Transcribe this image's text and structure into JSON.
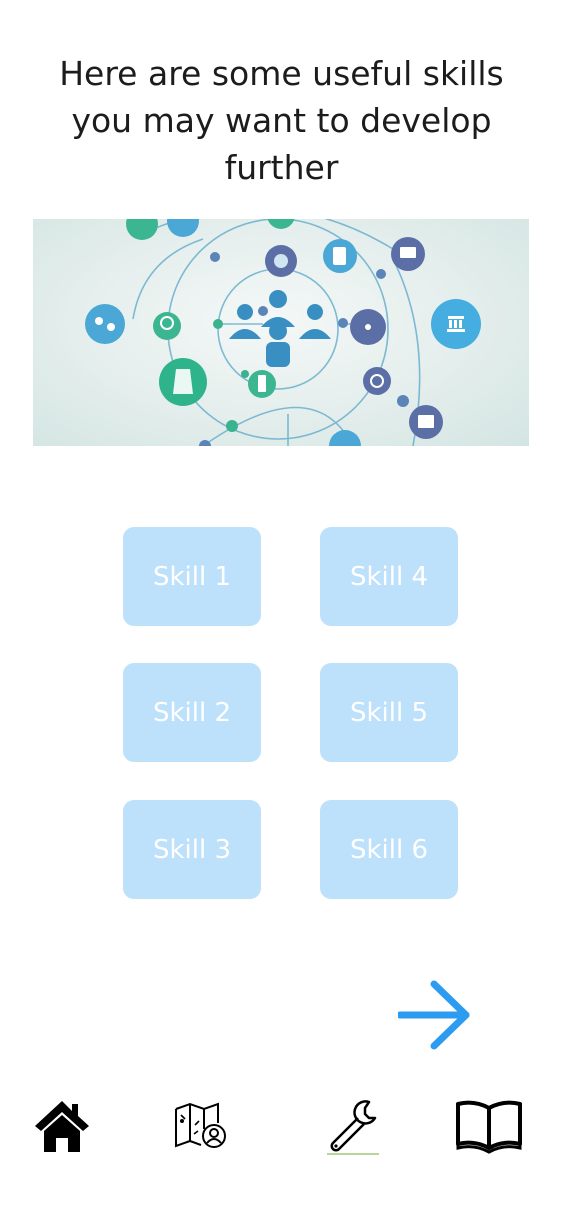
{
  "page": {
    "heading": "Here are some useful skills you may want to develop further"
  },
  "hero_image": {
    "icon": "skills-network-illustration"
  },
  "skills": [
    {
      "label": "Skill 1"
    },
    {
      "label": "Skill 2"
    },
    {
      "label": "Skill 3"
    },
    {
      "label": "Skill 4"
    },
    {
      "label": "Skill 5"
    },
    {
      "label": "Skill 6"
    }
  ],
  "next": {
    "icon": "arrow-right-icon"
  },
  "bottom_nav": {
    "items": [
      {
        "icon": "home-icon"
      },
      {
        "icon": "map-search-icon"
      },
      {
        "icon": "wrench-icon"
      },
      {
        "icon": "open-book-icon"
      }
    ]
  },
  "colors": {
    "skill_button_bg": "#bde0fb",
    "skill_button_text": "#ffffff",
    "accent_arrow": "#2d9bf0",
    "nav_icon": "#000000"
  }
}
